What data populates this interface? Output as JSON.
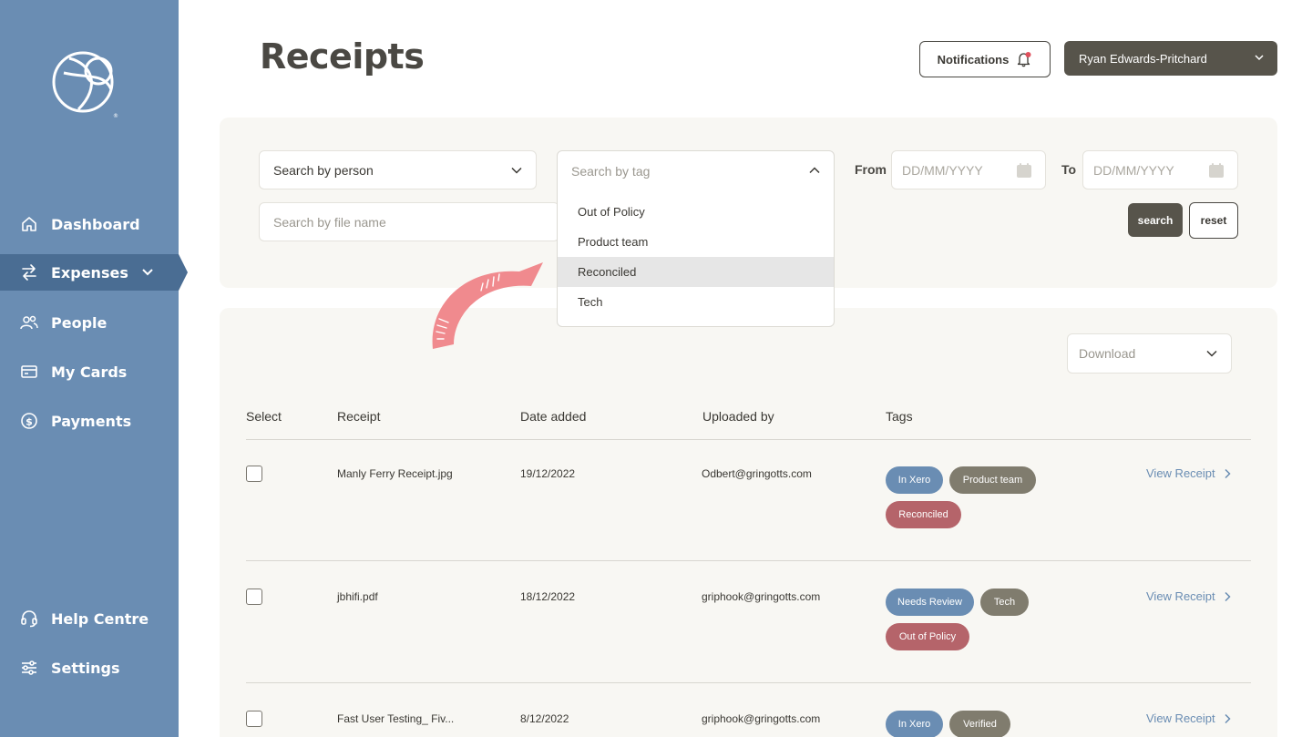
{
  "sidebar": {
    "nav": [
      {
        "label": "Dashboard",
        "icon": "home-icon"
      },
      {
        "label": "Expenses",
        "icon": "arrows-icon"
      },
      {
        "label": "People",
        "icon": "people-icon"
      },
      {
        "label": "My Cards",
        "icon": "card-icon"
      },
      {
        "label": "Payments",
        "icon": "dollar-icon"
      }
    ],
    "bottom": [
      {
        "label": "Help Centre",
        "icon": "headset-icon"
      },
      {
        "label": "Settings",
        "icon": "sliders-icon"
      }
    ],
    "colors": {
      "bg": "#6a8db3",
      "active": "#4a6d93"
    }
  },
  "header": {
    "title": "Receipts",
    "notifications_label": "Notifications",
    "user_name": "Ryan Edwards-Pritchard"
  },
  "filters": {
    "person_label": "Search by person",
    "tag_placeholder": "Search by tag",
    "file_placeholder": "Search by file name",
    "from_label": "From",
    "to_label": "To",
    "date_placeholder": "DD/MM/YYYY",
    "search_label": "search",
    "reset_label": "reset",
    "tag_options": [
      "Out of Policy",
      "Product team",
      "Reconciled",
      "Tech"
    ],
    "highlighted_option": "Reconciled"
  },
  "table": {
    "download_label": "Download",
    "columns": [
      "Select",
      "Receipt",
      "Date added",
      "Uploaded by",
      "Tags"
    ],
    "view_label": "View Receipt",
    "rows": [
      {
        "receipt": "Manly Ferry Receipt.jpg",
        "date": "19/12/2022",
        "uploader": "Odbert@gringotts.com",
        "tags": [
          "In Xero",
          "Product team",
          "Reconciled"
        ]
      },
      {
        "receipt": "jbhifi.pdf",
        "date": "18/12/2022",
        "uploader": "griphook@gringotts.com",
        "tags": [
          "Needs Review",
          "Tech",
          "Out of Policy"
        ]
      },
      {
        "receipt": "Fast User Testing_ Fiv...",
        "date": "8/12/2022",
        "uploader": "griphook@gringotts.com",
        "tags": [
          "In Xero",
          "Verified"
        ]
      }
    ]
  },
  "colors": {
    "blue_tag": "#6a8db3",
    "grey_tag": "#807c6e",
    "red_tag": "#b5646a",
    "accent_arrow": "#f08a8e"
  }
}
